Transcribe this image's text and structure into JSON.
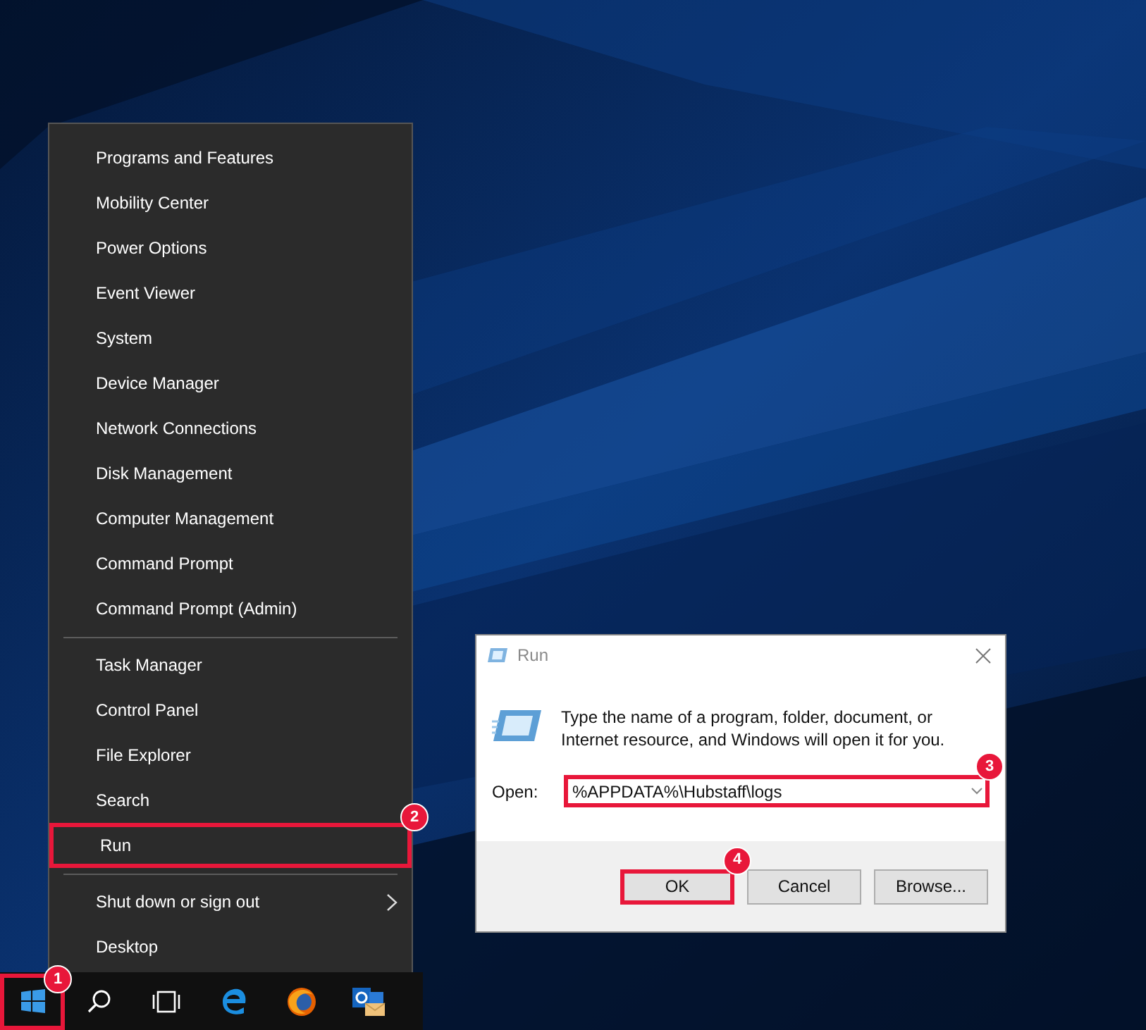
{
  "context_menu": {
    "groups": [
      {
        "items": [
          {
            "label": "Programs and Features",
            "highlighted": false,
            "submenu": false
          },
          {
            "label": "Mobility Center",
            "highlighted": false,
            "submenu": false
          },
          {
            "label": "Power Options",
            "highlighted": false,
            "submenu": false
          },
          {
            "label": "Event Viewer",
            "highlighted": false,
            "submenu": false
          },
          {
            "label": "System",
            "highlighted": false,
            "submenu": false
          },
          {
            "label": "Device Manager",
            "highlighted": false,
            "submenu": false
          },
          {
            "label": "Network Connections",
            "highlighted": false,
            "submenu": false
          },
          {
            "label": "Disk Management",
            "highlighted": false,
            "submenu": false
          },
          {
            "label": "Computer Management",
            "highlighted": false,
            "submenu": false
          },
          {
            "label": "Command Prompt",
            "highlighted": false,
            "submenu": false
          },
          {
            "label": "Command Prompt (Admin)",
            "highlighted": false,
            "submenu": false
          }
        ]
      },
      {
        "items": [
          {
            "label": "Task Manager",
            "highlighted": false,
            "submenu": false
          },
          {
            "label": "Control Panel",
            "highlighted": false,
            "submenu": false
          },
          {
            "label": "File Explorer",
            "highlighted": false,
            "submenu": false
          },
          {
            "label": "Search",
            "highlighted": false,
            "submenu": false
          },
          {
            "label": "Run",
            "highlighted": true,
            "submenu": false,
            "callout": "2"
          }
        ]
      },
      {
        "items": [
          {
            "label": "Shut down or sign out",
            "highlighted": false,
            "submenu": true
          },
          {
            "label": "Desktop",
            "highlighted": false,
            "submenu": false
          }
        ]
      }
    ]
  },
  "run_dialog": {
    "title": "Run",
    "description": "Type the name of a program, folder, document, or Internet resource, and Windows will open it for you.",
    "open_label": "Open:",
    "open_value": "%APPDATA%\\Hubstaff\\logs",
    "open_highlighted": true,
    "open_callout": "3",
    "buttons": [
      {
        "label": "OK",
        "highlighted": true,
        "callout": "4"
      },
      {
        "label": "Cancel",
        "highlighted": false
      },
      {
        "label": "Browse...",
        "highlighted": false
      }
    ]
  },
  "taskbar": {
    "start_highlighted": true,
    "start_callout": "1"
  }
}
